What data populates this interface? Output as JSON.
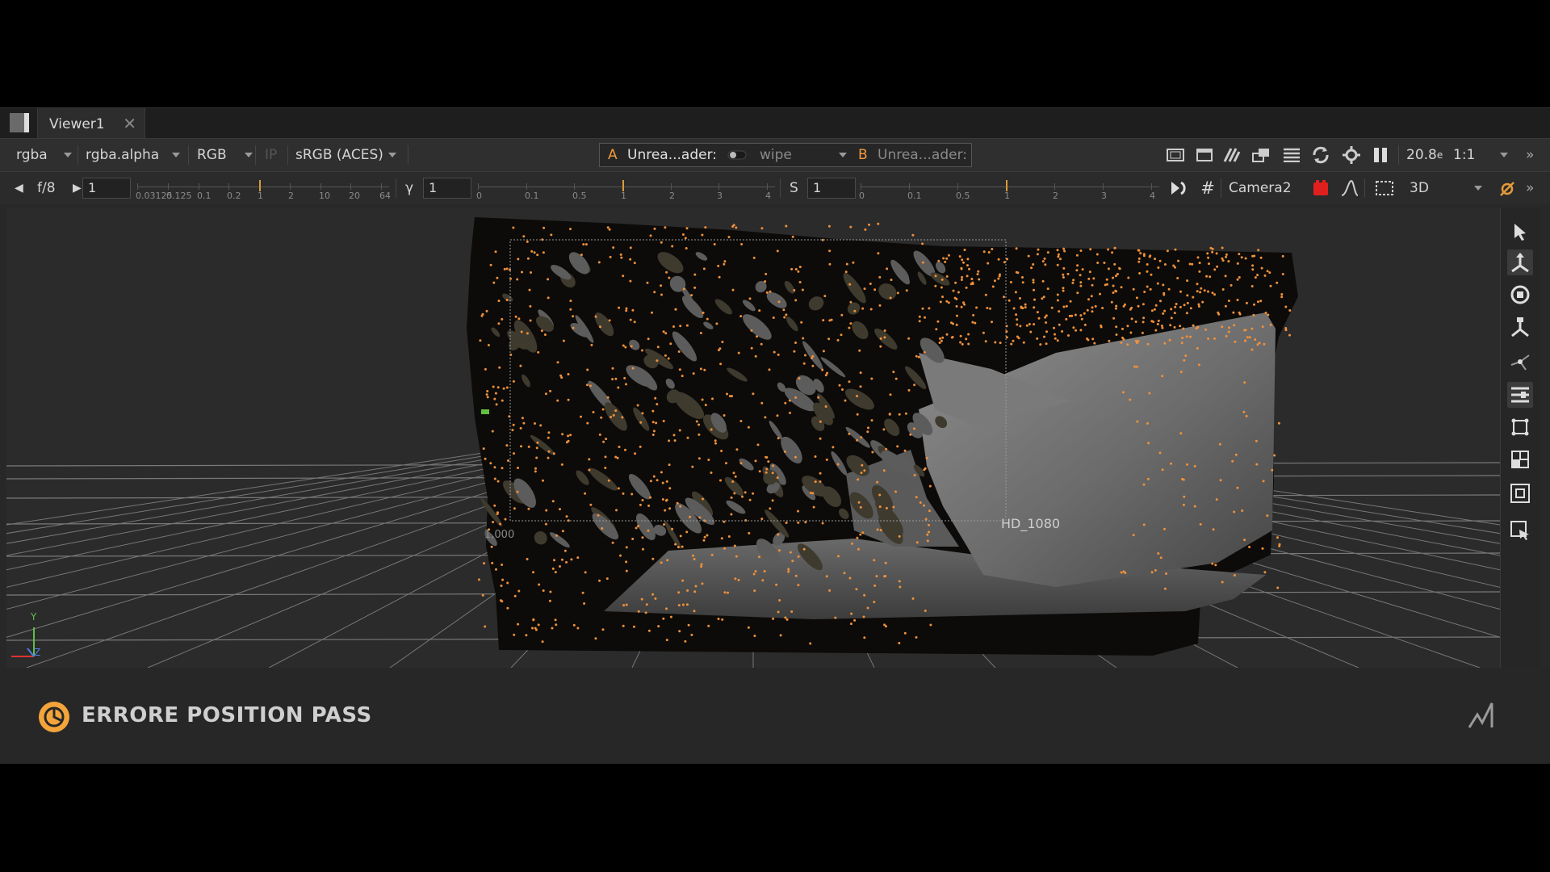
{
  "tabs": [
    {
      "label": "Viewer1",
      "close": "✕"
    }
  ],
  "toolbar1": {
    "channels": "rgba",
    "alpha": "rgba.alpha",
    "display": "RGB",
    "ip_label": "IP",
    "lut": "sRGB (ACES)",
    "input_a_letter": "A",
    "input_a": "Unrea...ader:",
    "wipe": "wipe",
    "input_b_letter": "B",
    "input_b": "Unrea...ader:",
    "zoom": "20.8",
    "zoom_suffix": "e",
    "ratio": "1:1"
  },
  "toolbar2": {
    "fstop": "f/8",
    "gain_value": "1",
    "gain_ticks": [
      "0.03125",
      "0.125",
      "0.1",
      "0.2",
      "1",
      "2",
      "10",
      "20",
      "64"
    ],
    "gain_level": 1,
    "gamma_label": "γ",
    "gamma_value": "1",
    "gamma_ticks": [
      "0",
      "0.1",
      "0.5",
      "1",
      "2",
      "3",
      "4"
    ],
    "gamma_level": 1,
    "s_label": "S",
    "s_value": "1",
    "s_ticks": [
      "0",
      "0.1",
      "0.5",
      "1",
      "2",
      "3",
      "4"
    ],
    "s_level": 1,
    "camera": "Camera2",
    "mode": "3D"
  },
  "viewport": {
    "format_label": "HD_1080",
    "frame_label": "1,000",
    "axis_y": "Y",
    "axis_z": "Z"
  },
  "caption": {
    "title": "ERRORE POSITION PASS"
  },
  "colors": {
    "accent": "#f19a3e",
    "background": "#282828",
    "points": "#f0903a"
  },
  "icons": {
    "sidebar": [
      "select-arrow-icon",
      "translate-icon",
      "rotate-icon",
      "scale-icon",
      "vertex-icon",
      "snap-icon",
      "align-icon",
      "frame-icon",
      "focus-icon",
      "selection-icon"
    ],
    "toolbar": [
      "roi-icon",
      "proxy-icon",
      "mask-icon",
      "overlay-icon",
      "lines-icon",
      "sync-icon",
      "settings-icon",
      "pause-icon"
    ]
  }
}
